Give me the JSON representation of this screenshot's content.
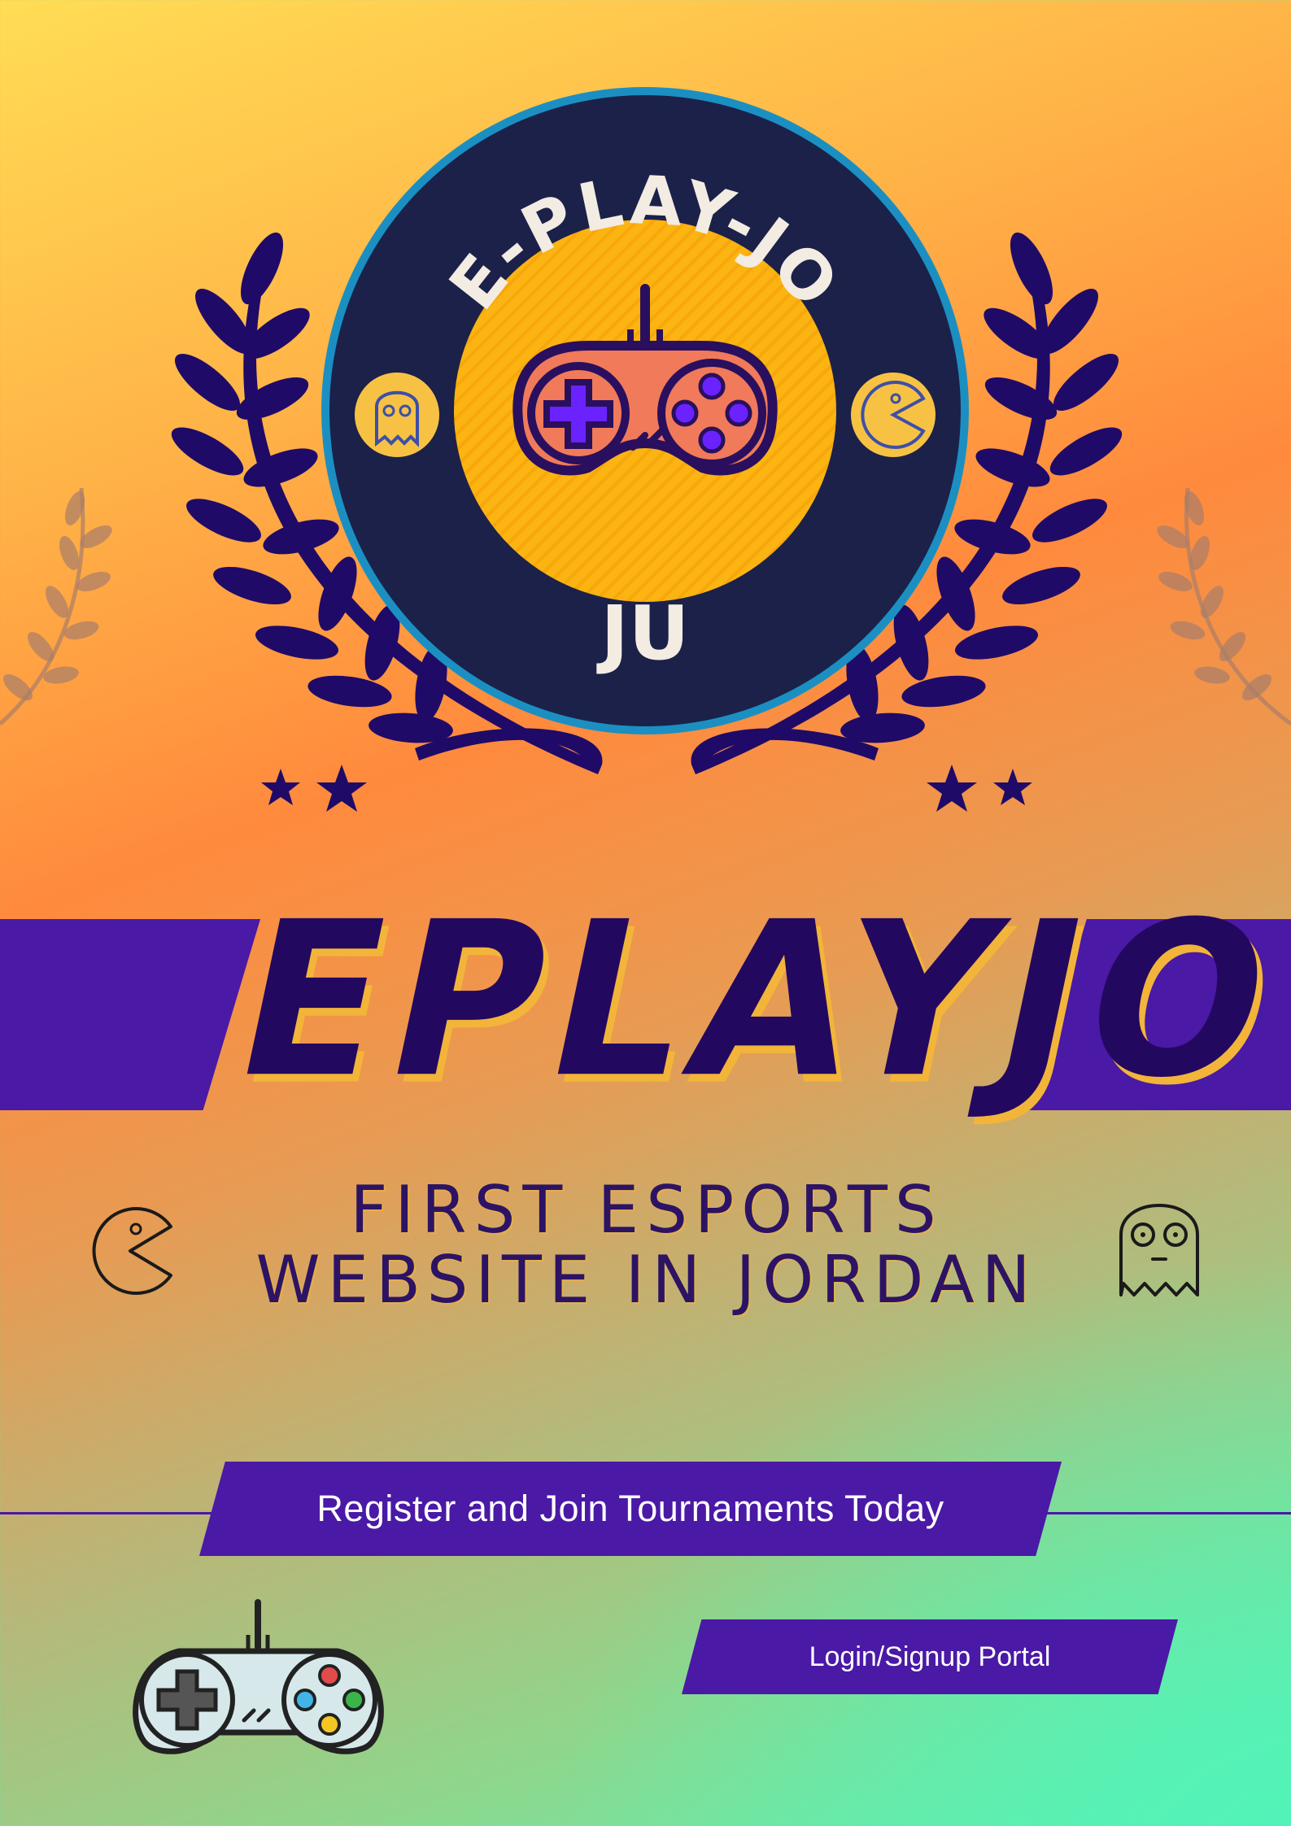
{
  "logo": {
    "top_text": "E-PLAY-JO",
    "bottom_text": "JU"
  },
  "brand": {
    "title": "EPLAYJO",
    "subtitle_line1": "FIRST ESPORTS",
    "subtitle_line2": "WEBSITE IN JORDAN"
  },
  "cta": {
    "label": "Register and Join Tournaments Today"
  },
  "login": {
    "label": "Login/Signup Portal"
  },
  "colors": {
    "primary_purple": "#4a19a6",
    "dark_navy": "#1b2149",
    "title_ink": "#23085f",
    "gold": "#fbb411",
    "accent_blue": "#1b8fc2"
  },
  "icons": [
    "laurel-wreath-icon",
    "gamepad-icon",
    "ghost-icon",
    "pacman-icon",
    "star-icon"
  ]
}
